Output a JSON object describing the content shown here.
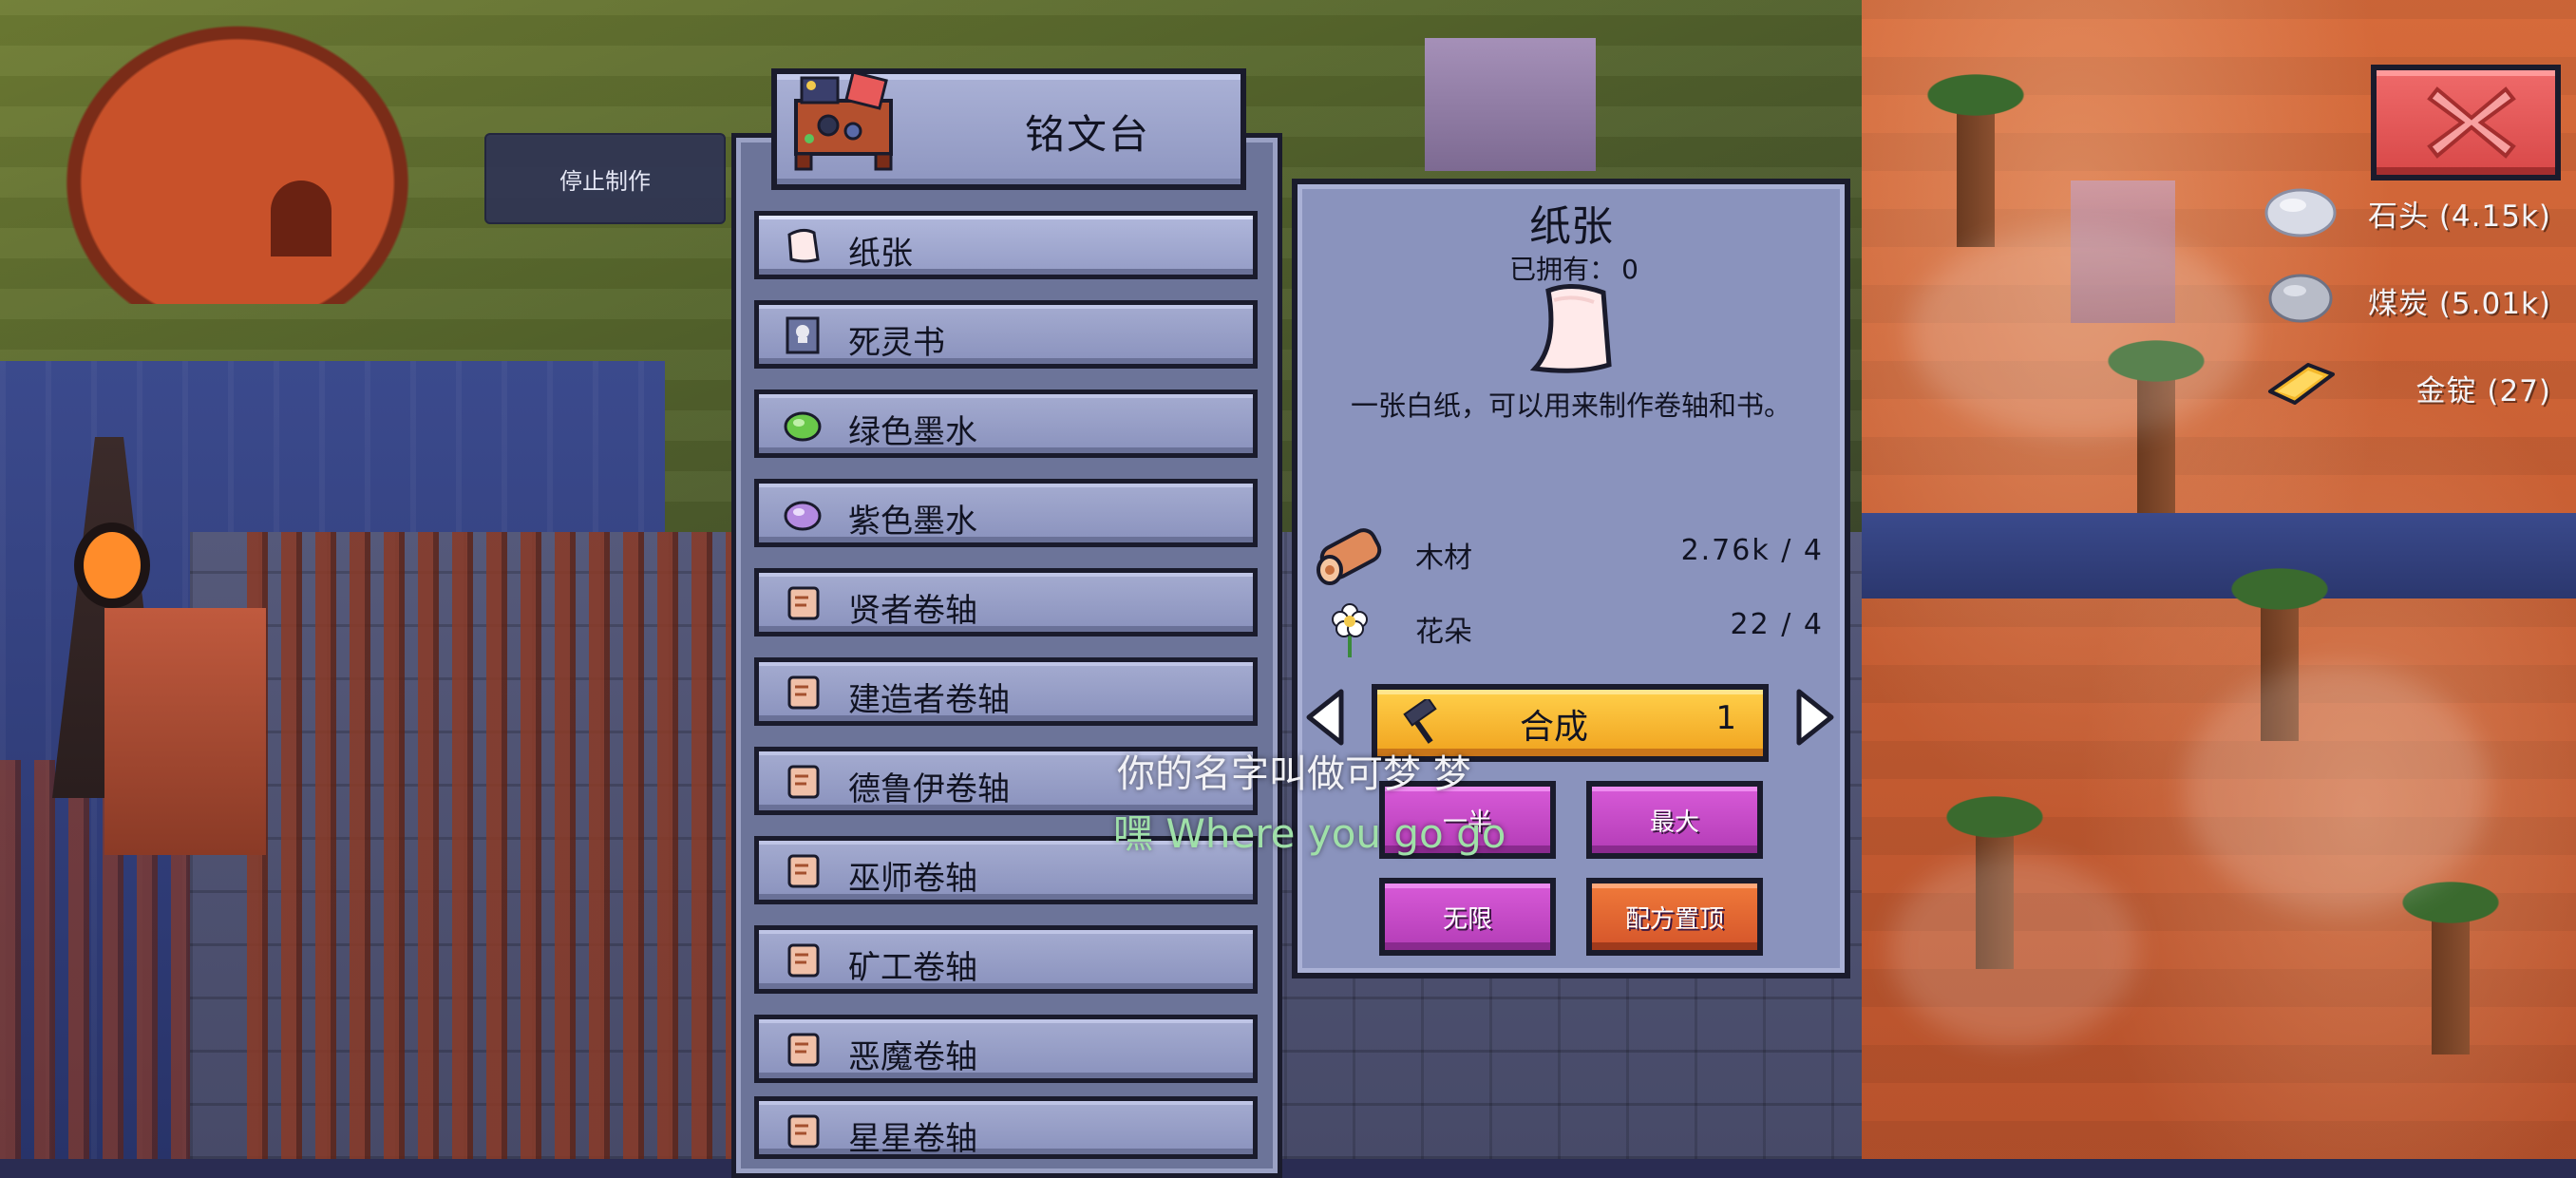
{
  "hud": {
    "stop_crafting_label": "停止制作",
    "close_icon": "close-x-icon"
  },
  "station": {
    "title": "铭文台",
    "icon": "inscription-table-icon"
  },
  "recipes": [
    {
      "label": "纸张",
      "icon": "paper-icon",
      "selected": true
    },
    {
      "label": "死灵书",
      "icon": "necro-book-icon"
    },
    {
      "label": "绿色墨水",
      "icon": "green-ink-icon"
    },
    {
      "label": "紫色墨水",
      "icon": "purple-ink-icon"
    },
    {
      "label": "贤者卷轴",
      "icon": "scroll-icon"
    },
    {
      "label": "建造者卷轴",
      "icon": "scroll-icon"
    },
    {
      "label": "德鲁伊卷轴",
      "icon": "scroll-icon"
    },
    {
      "label": "巫师卷轴",
      "icon": "scroll-icon"
    },
    {
      "label": "矿工卷轴",
      "icon": "scroll-icon"
    },
    {
      "label": "恶魔卷轴",
      "icon": "scroll-icon"
    },
    {
      "label": "星星卷轴",
      "icon": "scroll-icon"
    }
  ],
  "detail": {
    "title": "纸张",
    "owned_label": "已拥有：",
    "owned_value": "0",
    "description": "一张白纸，可以用来制作卷轴和书。",
    "ingredients": [
      {
        "name": "木材",
        "quantity": "2.76k / 4",
        "icon": "wood-log-icon"
      },
      {
        "name": "花朵",
        "quantity": "22 / 4",
        "icon": "flower-icon"
      }
    ],
    "craft_label": "合成",
    "craft_count": "1",
    "half_label": "一半",
    "max_label": "最大",
    "infinite_label": "无限",
    "pin_recipe_label": "配方置顶"
  },
  "resources": [
    {
      "label": "石头 (4.15k)",
      "icon": "stone-icon"
    },
    {
      "label": "煤炭 (5.01k)",
      "icon": "coal-icon"
    },
    {
      "label": "金锭 (27)",
      "icon": "gold-ingot-icon"
    }
  ],
  "subtitles": {
    "line1": "你的名字叫做可梦 梦",
    "line2": "嘿 Where you go go"
  },
  "colors": {
    "panel": "#8a93bd",
    "craft_button": "#f5b82c",
    "action_button": "#c848cc",
    "pin_button": "#e06432",
    "close_button": "#e05454"
  }
}
